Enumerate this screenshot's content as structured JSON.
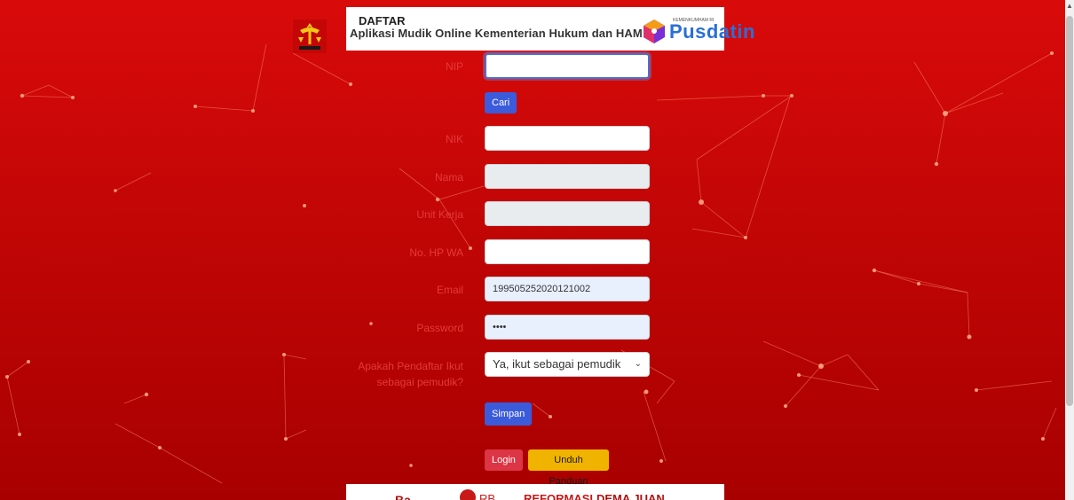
{
  "header": {
    "title": "DAFTAR",
    "subtitle": "Aplikasi Mudik Online Kementerian Hukum dan HAM",
    "logo_small": "KEMENKUMHAM RI",
    "logo_text": "Pusdatin"
  },
  "form": {
    "nip_label": "NIP",
    "nip_value": "",
    "cari_button": "Cari",
    "nik_label": "NIK",
    "nama_label": "Nama",
    "unit_label": "Unit Kerja",
    "hp_label": "No. HP WA",
    "email_label": "Email",
    "email_value": "199505252020121002",
    "password_label": "Password",
    "password_value": "••••",
    "ikut_label_line1": "Apakah Pendaftar Ikut",
    "ikut_label_line2": "sebagai pemudik?",
    "ikut_selected": "Ya, ikut sebagai pemudik",
    "simpan_button": "Simpan",
    "login_button": "Login",
    "panduan_button": "Unduh Panduan"
  },
  "banner": {
    "b1": "Ba...",
    "b2": "RB",
    "b3": "REFORMASI",
    "b4": "DEMA JUAN"
  },
  "colors": {
    "background": "#c40606",
    "primary": "#3b5bdb",
    "danger": "#dc3545",
    "warning": "#f0b400"
  }
}
